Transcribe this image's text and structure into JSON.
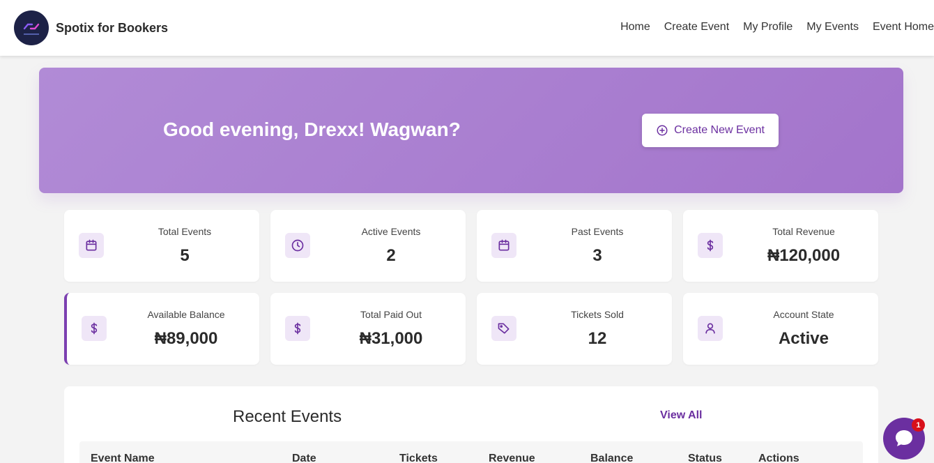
{
  "header": {
    "brand": "Spotix for Bookers",
    "logo_icon": "spotix-logo-icon",
    "nav": [
      "Home",
      "Create Event",
      "My Profile",
      "My Events",
      "Event Home"
    ]
  },
  "hero": {
    "greeting": "Good evening, Drexx! Wagwan?",
    "create_button": "Create New Event",
    "create_icon": "plus-circle-icon"
  },
  "stats": [
    {
      "label": "Total Events",
      "value": "5",
      "icon": "calendar-icon"
    },
    {
      "label": "Active Events",
      "value": "2",
      "icon": "clock-icon"
    },
    {
      "label": "Past Events",
      "value": "3",
      "icon": "calendar-icon"
    },
    {
      "label": "Total Revenue",
      "value": "₦120,000",
      "icon": "dollar-icon"
    },
    {
      "label": "Available Balance",
      "value": "₦89,000",
      "icon": "dollar-icon"
    },
    {
      "label": "Total Paid Out",
      "value": "₦31,000",
      "icon": "dollar-icon"
    },
    {
      "label": "Tickets Sold",
      "value": "12",
      "icon": "tag-icon"
    },
    {
      "label": "Account State",
      "value": "Active",
      "icon": "user-icon"
    }
  ],
  "recent_events": {
    "title": "Recent Events",
    "view_all": "View All",
    "columns": [
      "Event Name",
      "Date",
      "Tickets",
      "Revenue",
      "Balance",
      "Status",
      "Actions"
    ]
  },
  "chat": {
    "badge_count": "1",
    "icon": "chat-bubble-icon"
  },
  "colors": {
    "accent": "#6b2fa0",
    "hero_start": "#b18bd6",
    "hero_end": "#a374cb",
    "badge": "#d8101a"
  }
}
